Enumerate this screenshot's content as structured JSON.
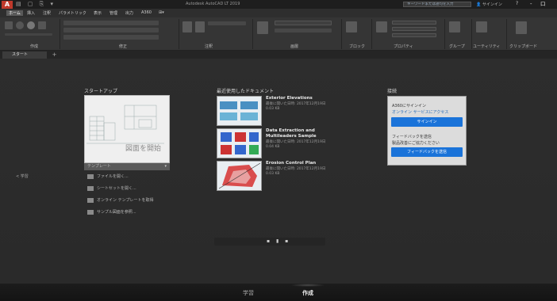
{
  "window": {
    "logo": "A",
    "title": "Autodesk AutoCAD LT 2019",
    "search_placeholder": "キーワードまたは語句を入力",
    "signin": "サインイン",
    "help": "?",
    "controls": "- ロ X"
  },
  "menubar": {
    "items": [
      "ホーム",
      "挿入",
      "注釈",
      "パラメトリック",
      "表示",
      "管理",
      "出力",
      "A360"
    ]
  },
  "ribbon": {
    "panels": [
      "作成",
      "修正",
      "注釈",
      "画層",
      "ブロック",
      "プロパティ",
      "グループ",
      "ユーティリティ",
      "クリップボード"
    ]
  },
  "doc_tabs": {
    "tabs": [
      "スタート"
    ],
    "add": "+"
  },
  "startup": {
    "title": "スタートアップ",
    "start_drawing": "図面を開始",
    "template_label": "テンプレート",
    "links": [
      "ファイルを開く...",
      "シートセットを開く...",
      "オンライン テンプレートを取得",
      "サンプル図面を参照..."
    ]
  },
  "recent": {
    "title": "最近使用したドキュメント",
    "items": [
      {
        "name": "Exterior Elevations",
        "opened": "最後に開いた日時: 2017年12月19日",
        "size": "0.03 KB"
      },
      {
        "name": "Data Extraction and Multileaders Sample",
        "opened": "最後に開いた日時: 2017年12月19日",
        "size": "0.04 KB"
      },
      {
        "name": "Erosion Control Plan",
        "opened": "最後に開いた日時: 2017年12月19日",
        "size": "0.03 KB"
      }
    ]
  },
  "connect": {
    "title": "接続",
    "signin_heading": "A360にサインイン",
    "signin_desc": "オンライン サービスにアクセス",
    "signin_button": "サインイン",
    "feedback_heading": "フィードバックを送信",
    "feedback_desc": "製品改善にご協力ください",
    "feedback_button": "フィードバックを送信"
  },
  "side": {
    "label": "< 学習"
  },
  "bottom": {
    "learn": "学習",
    "create": "作成"
  }
}
